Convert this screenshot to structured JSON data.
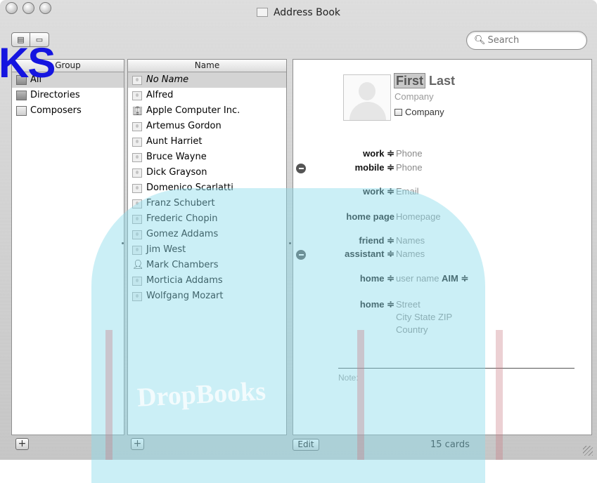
{
  "window": {
    "title": "Address Book"
  },
  "toolbar": {
    "search_placeholder": "Search"
  },
  "group_pane": {
    "header": "Group",
    "items": [
      {
        "label": "All"
      },
      {
        "label": "Directories"
      },
      {
        "label": "Composers"
      }
    ]
  },
  "name_pane": {
    "header": "Name",
    "items": [
      {
        "label": "No Name",
        "icon": "card-icon"
      },
      {
        "label": "Alfred",
        "icon": "card-icon"
      },
      {
        "label": "Apple Computer Inc.",
        "icon": "company-icon"
      },
      {
        "label": "Artemus Gordon",
        "icon": "card-icon"
      },
      {
        "label": "Aunt Harriet",
        "icon": "card-icon"
      },
      {
        "label": "Bruce Wayne",
        "icon": "card-icon"
      },
      {
        "label": "Dick Grayson",
        "icon": "card-icon"
      },
      {
        "label": "Domenico Scarlatti",
        "icon": "card-icon"
      },
      {
        "label": "Franz Schubert",
        "icon": "card-icon"
      },
      {
        "label": "Frederic Chopin",
        "icon": "card-icon"
      },
      {
        "label": "Gomez Addams",
        "icon": "card-icon"
      },
      {
        "label": "Jim West",
        "icon": "card-icon"
      },
      {
        "label": "Mark Chambers",
        "icon": "person-icon"
      },
      {
        "label": "Morticia Addams",
        "icon": "card-icon"
      },
      {
        "label": "Wolfgang Mozart",
        "icon": "card-icon"
      }
    ]
  },
  "card": {
    "first": "First",
    "last": "Last",
    "company_placeholder": "Company",
    "company_checkbox_label": "Company",
    "fields": {
      "work_phone_label": "work ≑",
      "work_phone_value": "Phone",
      "mobile_phone_label": "mobile ≑",
      "mobile_phone_value": "Phone",
      "work_email_label": "work ≑",
      "work_email_value": "Email",
      "homepage_label": "home page",
      "homepage_value": "Homepage",
      "friend_label": "friend ≑",
      "friend_value": "Names",
      "assistant_label": "assistant ≑",
      "assistant_value": "Names",
      "aim_label": "home ≑",
      "aim_value": "user name",
      "aim_service": "AIM ≑",
      "address_label": "home ≑",
      "street": "Street",
      "city_state_zip": "City State ZIP",
      "country": "Country"
    },
    "note_label": "Note:"
  },
  "bottom": {
    "edit_label": "Edit",
    "card_count": "15 cards",
    "add_group": "+",
    "add_card": "+"
  },
  "watermark": {
    "text_top": "KS",
    "text_book": "DropBooks"
  }
}
